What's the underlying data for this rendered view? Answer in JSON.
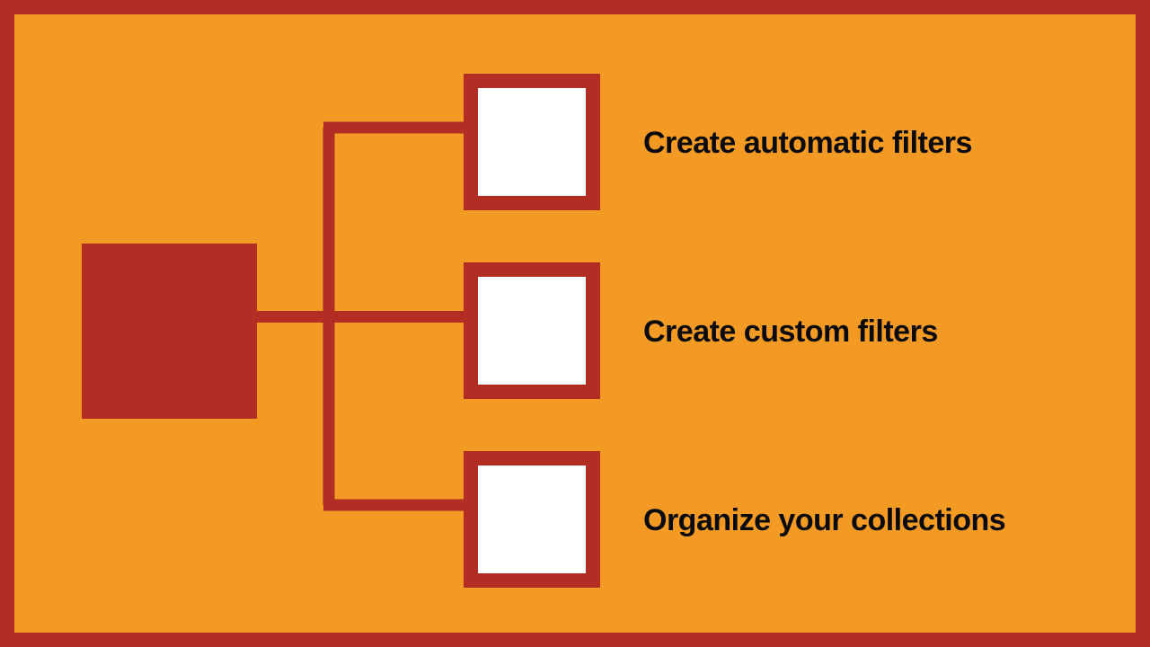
{
  "diagram": {
    "colors": {
      "frame": "#B22D24",
      "bg": "#F29A24",
      "node_fill": "#ffffff",
      "text": "#0a0a0a"
    },
    "root": {
      "kind": "solid-square"
    },
    "children": [
      {
        "kind": "hollow-square",
        "label": "Create automatic filters"
      },
      {
        "kind": "hollow-square",
        "label": "Create custom filters"
      },
      {
        "kind": "hollow-square",
        "label": "Organize your collections"
      }
    ]
  }
}
